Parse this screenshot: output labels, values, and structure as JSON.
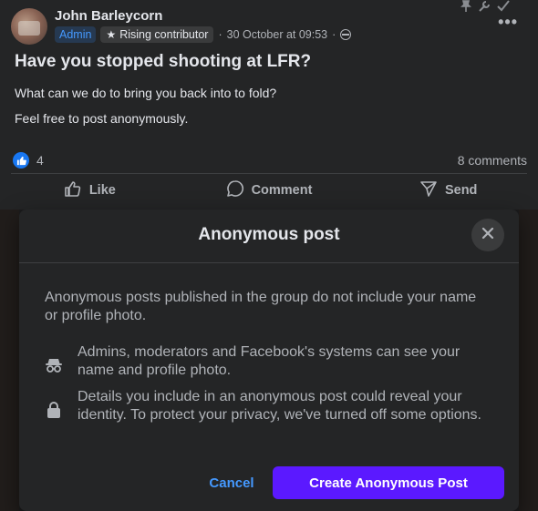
{
  "post": {
    "author": "John Barleycorn",
    "badges": {
      "admin": "Admin",
      "rising": "Rising contributor"
    },
    "timestamp": "30 October at 09:53",
    "separator": "·",
    "title": "Have you stopped shooting at LFR?",
    "body": [
      "What can we do to bring you back into to fold?",
      "Feel free to post anonymously."
    ],
    "like_count": "4",
    "comments": "8 comments",
    "actions": {
      "like": "Like",
      "comment": "Comment",
      "send": "Send"
    },
    "more": "•••"
  },
  "modal": {
    "title": "Anonymous post",
    "intro": "Anonymous posts published in the group do not include your name or profile photo.",
    "items": [
      {
        "icon": "incognito-icon",
        "text": "Admins, moderators and Facebook's systems can see your name and profile photo."
      },
      {
        "icon": "lock-icon",
        "text": "Details you include in an anonymous post could reveal your identity. To protect your privacy, we've turned off some options."
      }
    ],
    "cancel": "Cancel",
    "create": "Create Anonymous Post"
  },
  "colors": {
    "accent": "#5b19ff",
    "link": "#4599ff",
    "like_blue": "#1877f2"
  }
}
